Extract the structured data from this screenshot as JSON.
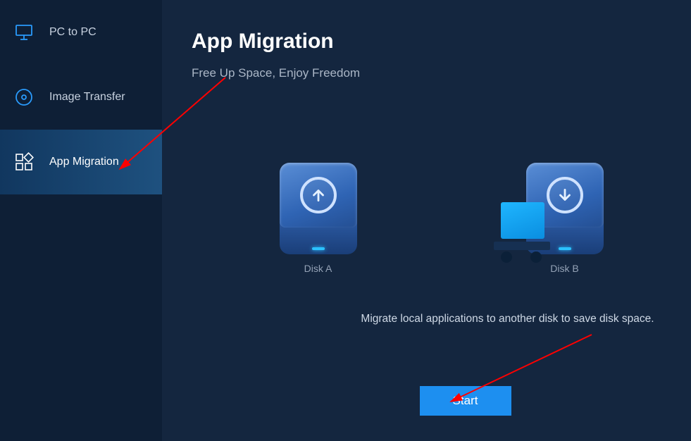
{
  "sidebar": {
    "items": [
      {
        "label": "PC to PC",
        "icon": "monitor-icon"
      },
      {
        "label": "Image Transfer",
        "icon": "disc-icon"
      },
      {
        "label": "App Migration",
        "icon": "grid-icon"
      }
    ],
    "active_index": 2
  },
  "main": {
    "title": "App Migration",
    "subtitle": "Free Up Space, Enjoy Freedom",
    "disk_a_label": "Disk A",
    "disk_b_label": "Disk B",
    "description": "Migrate local applications to another disk to save disk space.",
    "start_label": "Start"
  },
  "colors": {
    "accent": "#1d8ff0",
    "sidebar_bg": "#0e1f36",
    "main_bg": "#14263f"
  }
}
